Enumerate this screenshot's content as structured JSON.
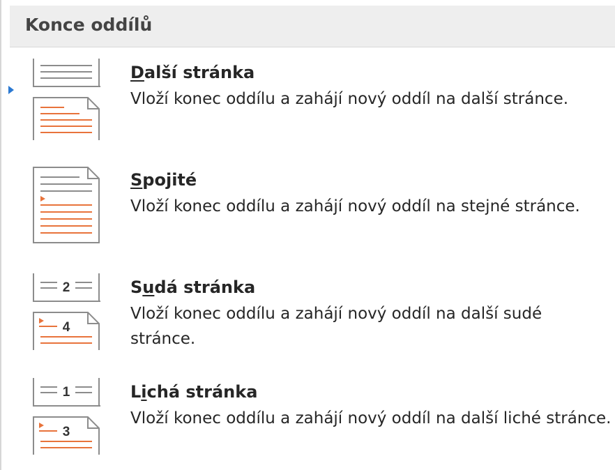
{
  "section": {
    "title": "Konce oddílů"
  },
  "items": [
    {
      "title_pre": "",
      "title_key": "D",
      "title_post": "alší stránka",
      "description": "Vloží konec oddílu a zahájí nový oddíl na další stránce.",
      "icon": "next-page-break-icon",
      "selected": true
    },
    {
      "title_pre": "",
      "title_key": "S",
      "title_post": "pojité",
      "description": "Vloží konec oddílu a zahájí nový oddíl na stejné stránce.",
      "icon": "continuous-break-icon",
      "selected": false
    },
    {
      "title_pre": "S",
      "title_key": "u",
      "title_post": "dá stránka",
      "description": "Vloží konec oddílu a zahájí nový oddíl na další sudé stránce.",
      "icon": "even-page-break-icon",
      "selected": false,
      "icon_numbers": [
        "2",
        "4"
      ]
    },
    {
      "title_pre": "L",
      "title_key": "i",
      "title_post": "chá stránka",
      "description": "Vloží konec oddílu a zahájí nový oddíl na další liché stránce.",
      "icon": "odd-page-break-icon",
      "selected": false,
      "icon_numbers": [
        "1",
        "3"
      ]
    }
  ],
  "colors": {
    "accent_orange": "#e8733b",
    "line_gray": "#8c8c8c",
    "selection_blue": "#2b79d2"
  }
}
